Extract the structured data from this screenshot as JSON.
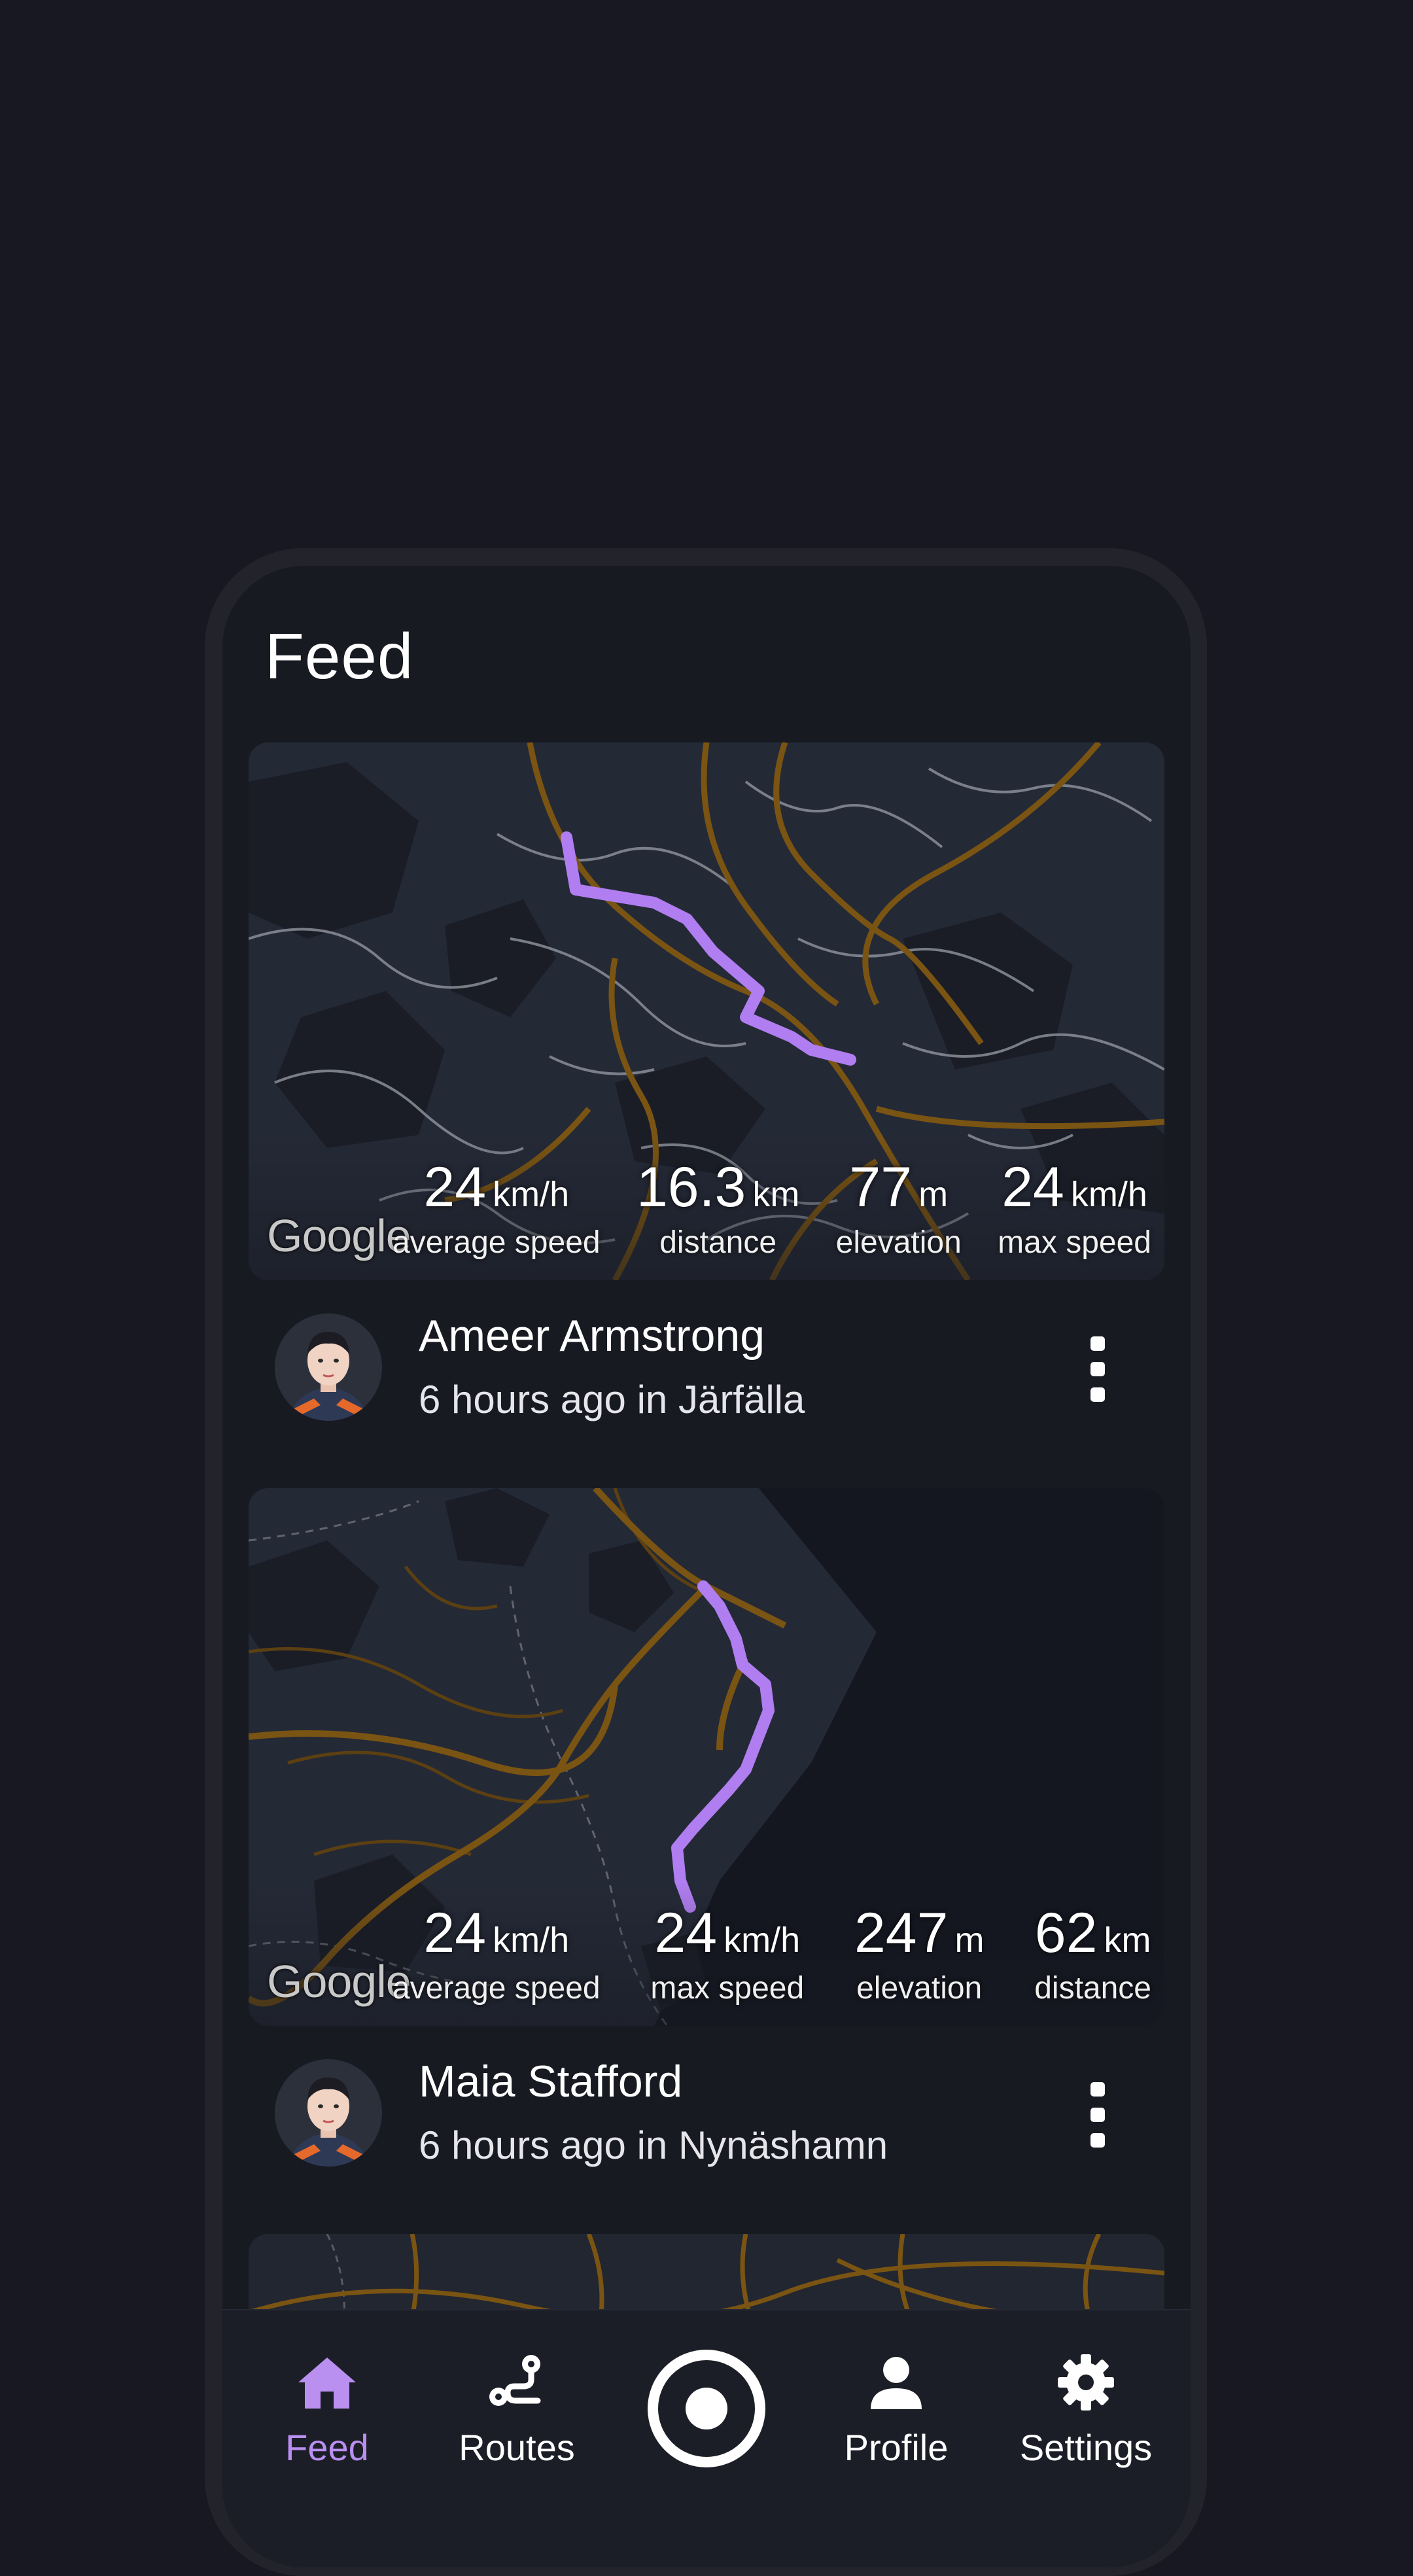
{
  "feed": {
    "title": "Feed"
  },
  "posts": [
    {
      "map_attribution": "Google",
      "stats": [
        {
          "value": "24",
          "unit": "km/h",
          "label": "average speed"
        },
        {
          "value": "16.3",
          "unit": "km",
          "label": "distance"
        },
        {
          "value": "77",
          "unit": "m",
          "label": "elevation"
        },
        {
          "value": "24",
          "unit": "km/h",
          "label": "max speed"
        }
      ],
      "user_name": "Ameer Armstrong",
      "meta": "6 hours ago in Järfälla"
    },
    {
      "map_attribution": "Google",
      "stats": [
        {
          "value": "24",
          "unit": "km/h",
          "label": "average speed"
        },
        {
          "value": "24",
          "unit": "km/h",
          "label": "max speed"
        },
        {
          "value": "247",
          "unit": "m",
          "label": "elevation"
        },
        {
          "value": "62",
          "unit": "km",
          "label": "distance"
        }
      ],
      "user_name": "Maia Stafford",
      "meta": "6 hours ago in Nynäshamn"
    }
  ],
  "nav": {
    "items": [
      {
        "label": "Feed",
        "icon": "home-icon",
        "active": true
      },
      {
        "label": "Routes",
        "icon": "route-icon",
        "active": false
      },
      {
        "label": "",
        "icon": "record-icon",
        "active": false
      },
      {
        "label": "Profile",
        "icon": "person-icon",
        "active": false
      },
      {
        "label": "Settings",
        "icon": "gear-icon",
        "active": false
      }
    ]
  },
  "colors": {
    "background": "#181822",
    "screen": "#181a22",
    "accent": "#b98ff0",
    "route": "#b07ef0",
    "major_road": "#7a5412",
    "minor_road": "#8a8e98",
    "map_land": "#252a35",
    "map_water": "#151820"
  }
}
